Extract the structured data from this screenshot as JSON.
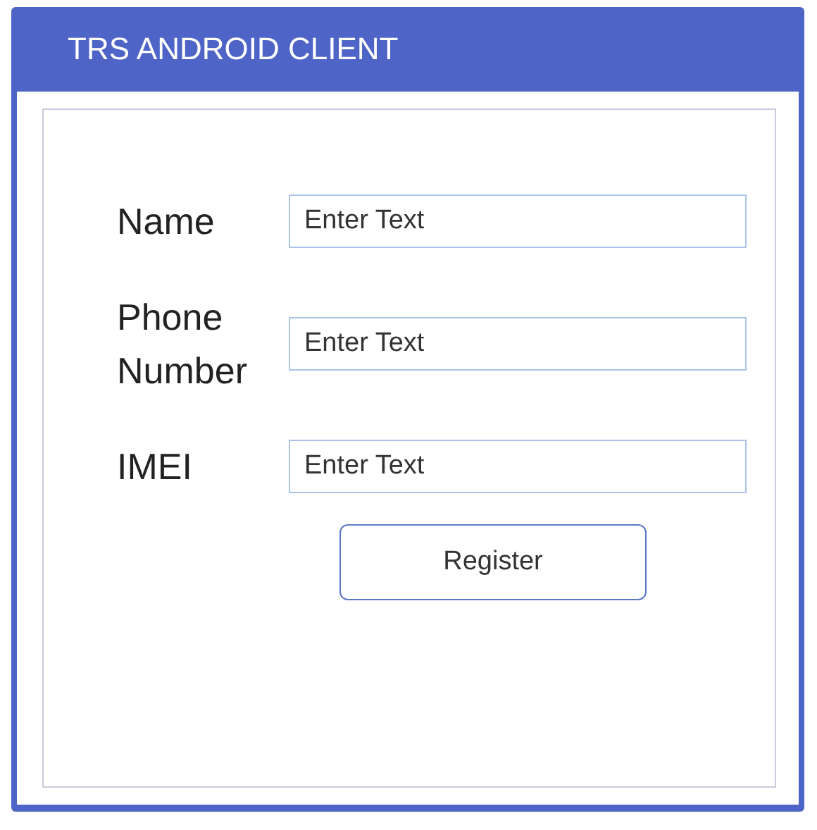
{
  "window": {
    "title": "TRS ANDROID CLIENT"
  },
  "fields": [
    {
      "label": "Name",
      "placeholder": "Enter Text"
    },
    {
      "label": "Phone Number",
      "placeholder": "Enter Text"
    },
    {
      "label": "IMEI",
      "placeholder": "Enter Text"
    }
  ],
  "buttons": [
    "Register"
  ]
}
